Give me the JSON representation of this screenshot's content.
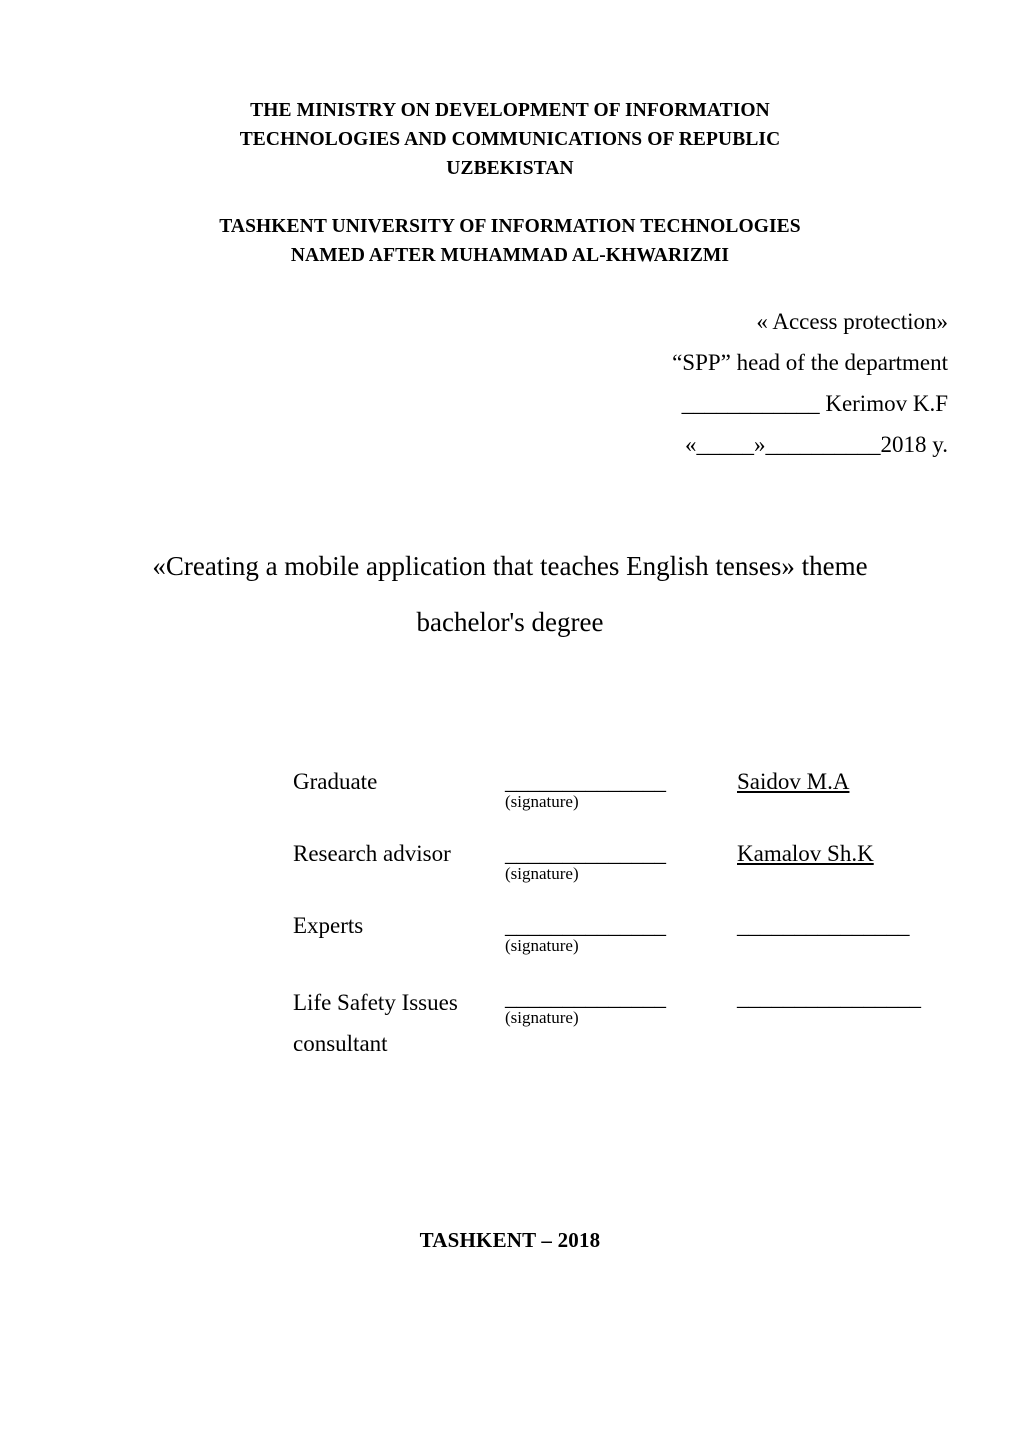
{
  "document": {
    "type": "thesis-title-page",
    "background_color": "#ffffff",
    "text_color": "#000000"
  },
  "header": {
    "ministry_lines": [
      "THE MINISTRY ON DEVELOPMENT OF INFORMATION",
      "TECHNOLOGIES AND COMMUNICATIONS OF REPUBLIC",
      "UZBEKISTAN"
    ],
    "university_lines": [
      "TASHKENT UNIVERSITY OF INFORMATION TECHNOLOGIES",
      "NAMED AFTER MUHAMMAD AL-KHWARIZMI"
    ]
  },
  "approval": {
    "lines": [
      "« Access protection»",
      "“SPP” head of the department",
      "____________ Kerimov K.F",
      "«_____»__________2018 y."
    ]
  },
  "title": {
    "text": "«Creating a mobile application that teaches English tenses» theme bachelor's degree"
  },
  "signatures": {
    "signature_caption": "(signature)",
    "signature_blank": "______________",
    "name_blank": "_______________",
    "rows": [
      {
        "role": "Graduate",
        "role_second_line": "",
        "signature_blank": "______________",
        "caption": "(signature)",
        "name": "Saidov M.A",
        "name_is_blank": false
      },
      {
        "role": "Research advisor",
        "role_second_line": "",
        "signature_blank": "______________",
        "caption": "(signature)",
        "name": "Kamalov Sh.K",
        "name_is_blank": false
      },
      {
        "role": "Experts",
        "role_second_line": "",
        "signature_blank": "______________",
        "caption": "(signature)",
        "name": "_______________",
        "name_is_blank": true
      },
      {
        "role": "Life Safety Issues",
        "role_second_line": "consultant",
        "signature_blank": "______________",
        "caption": "(signature)",
        "name": "________________",
        "name_is_blank": true
      }
    ]
  },
  "footer": {
    "city_year": "TASHKENT – 2018"
  }
}
